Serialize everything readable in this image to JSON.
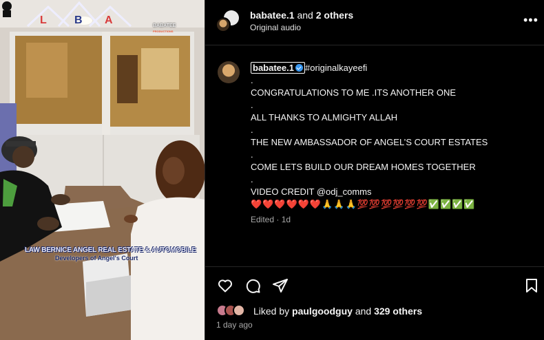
{
  "media": {
    "watermark_top": "BABATEE",
    "watermark_sub": "PRODUCTIONS",
    "logo_letters": "LBA",
    "company_name": "LAW BERNICE ANGEL REAL ESTATE & AUTOMOBILE",
    "company_tagline": "Developers of Angel's Court"
  },
  "header": {
    "username": "babatee.1",
    "and_text": "and",
    "others": "2 others",
    "audio": "Original audio",
    "more_label": "•••"
  },
  "caption": {
    "username": "babatee.1",
    "hashtag": "#originalkayeefi",
    "lines": [
      ".",
      "CONGRATULATIONS TO ME .ITS ANOTHER ONE",
      ".",
      "ALL THANKS TO ALMIGHTY ALLAH",
      ".",
      "THE NEW AMBASSADOR OF ANGEL’S COURT ESTATES",
      ".",
      "COME LETS BUILD OUR DREAM HOMES TOGETHER",
      ".",
      "VIDEO CREDIT @odj_comms"
    ],
    "emojis": "❤️❤️❤️❤️❤️❤️🙏🙏🙏💯💯💯💯💯💯✅✅✅✅",
    "edited": "Edited · 1d"
  },
  "actions": {
    "liked_by_prefix": "Liked by",
    "liked_by_user": "paulgoodguy",
    "liked_by_and": "and",
    "liked_by_count": "329 others",
    "time_ago": "1 day ago"
  },
  "colors": {
    "background": "#000000",
    "divider": "#262626",
    "secondary_text": "#a8a8a8",
    "verified": "#3897f0"
  },
  "icons": [
    "heart-icon",
    "comment-icon",
    "share-icon",
    "bookmark-icon",
    "more-icon",
    "verified-badge-icon"
  ]
}
